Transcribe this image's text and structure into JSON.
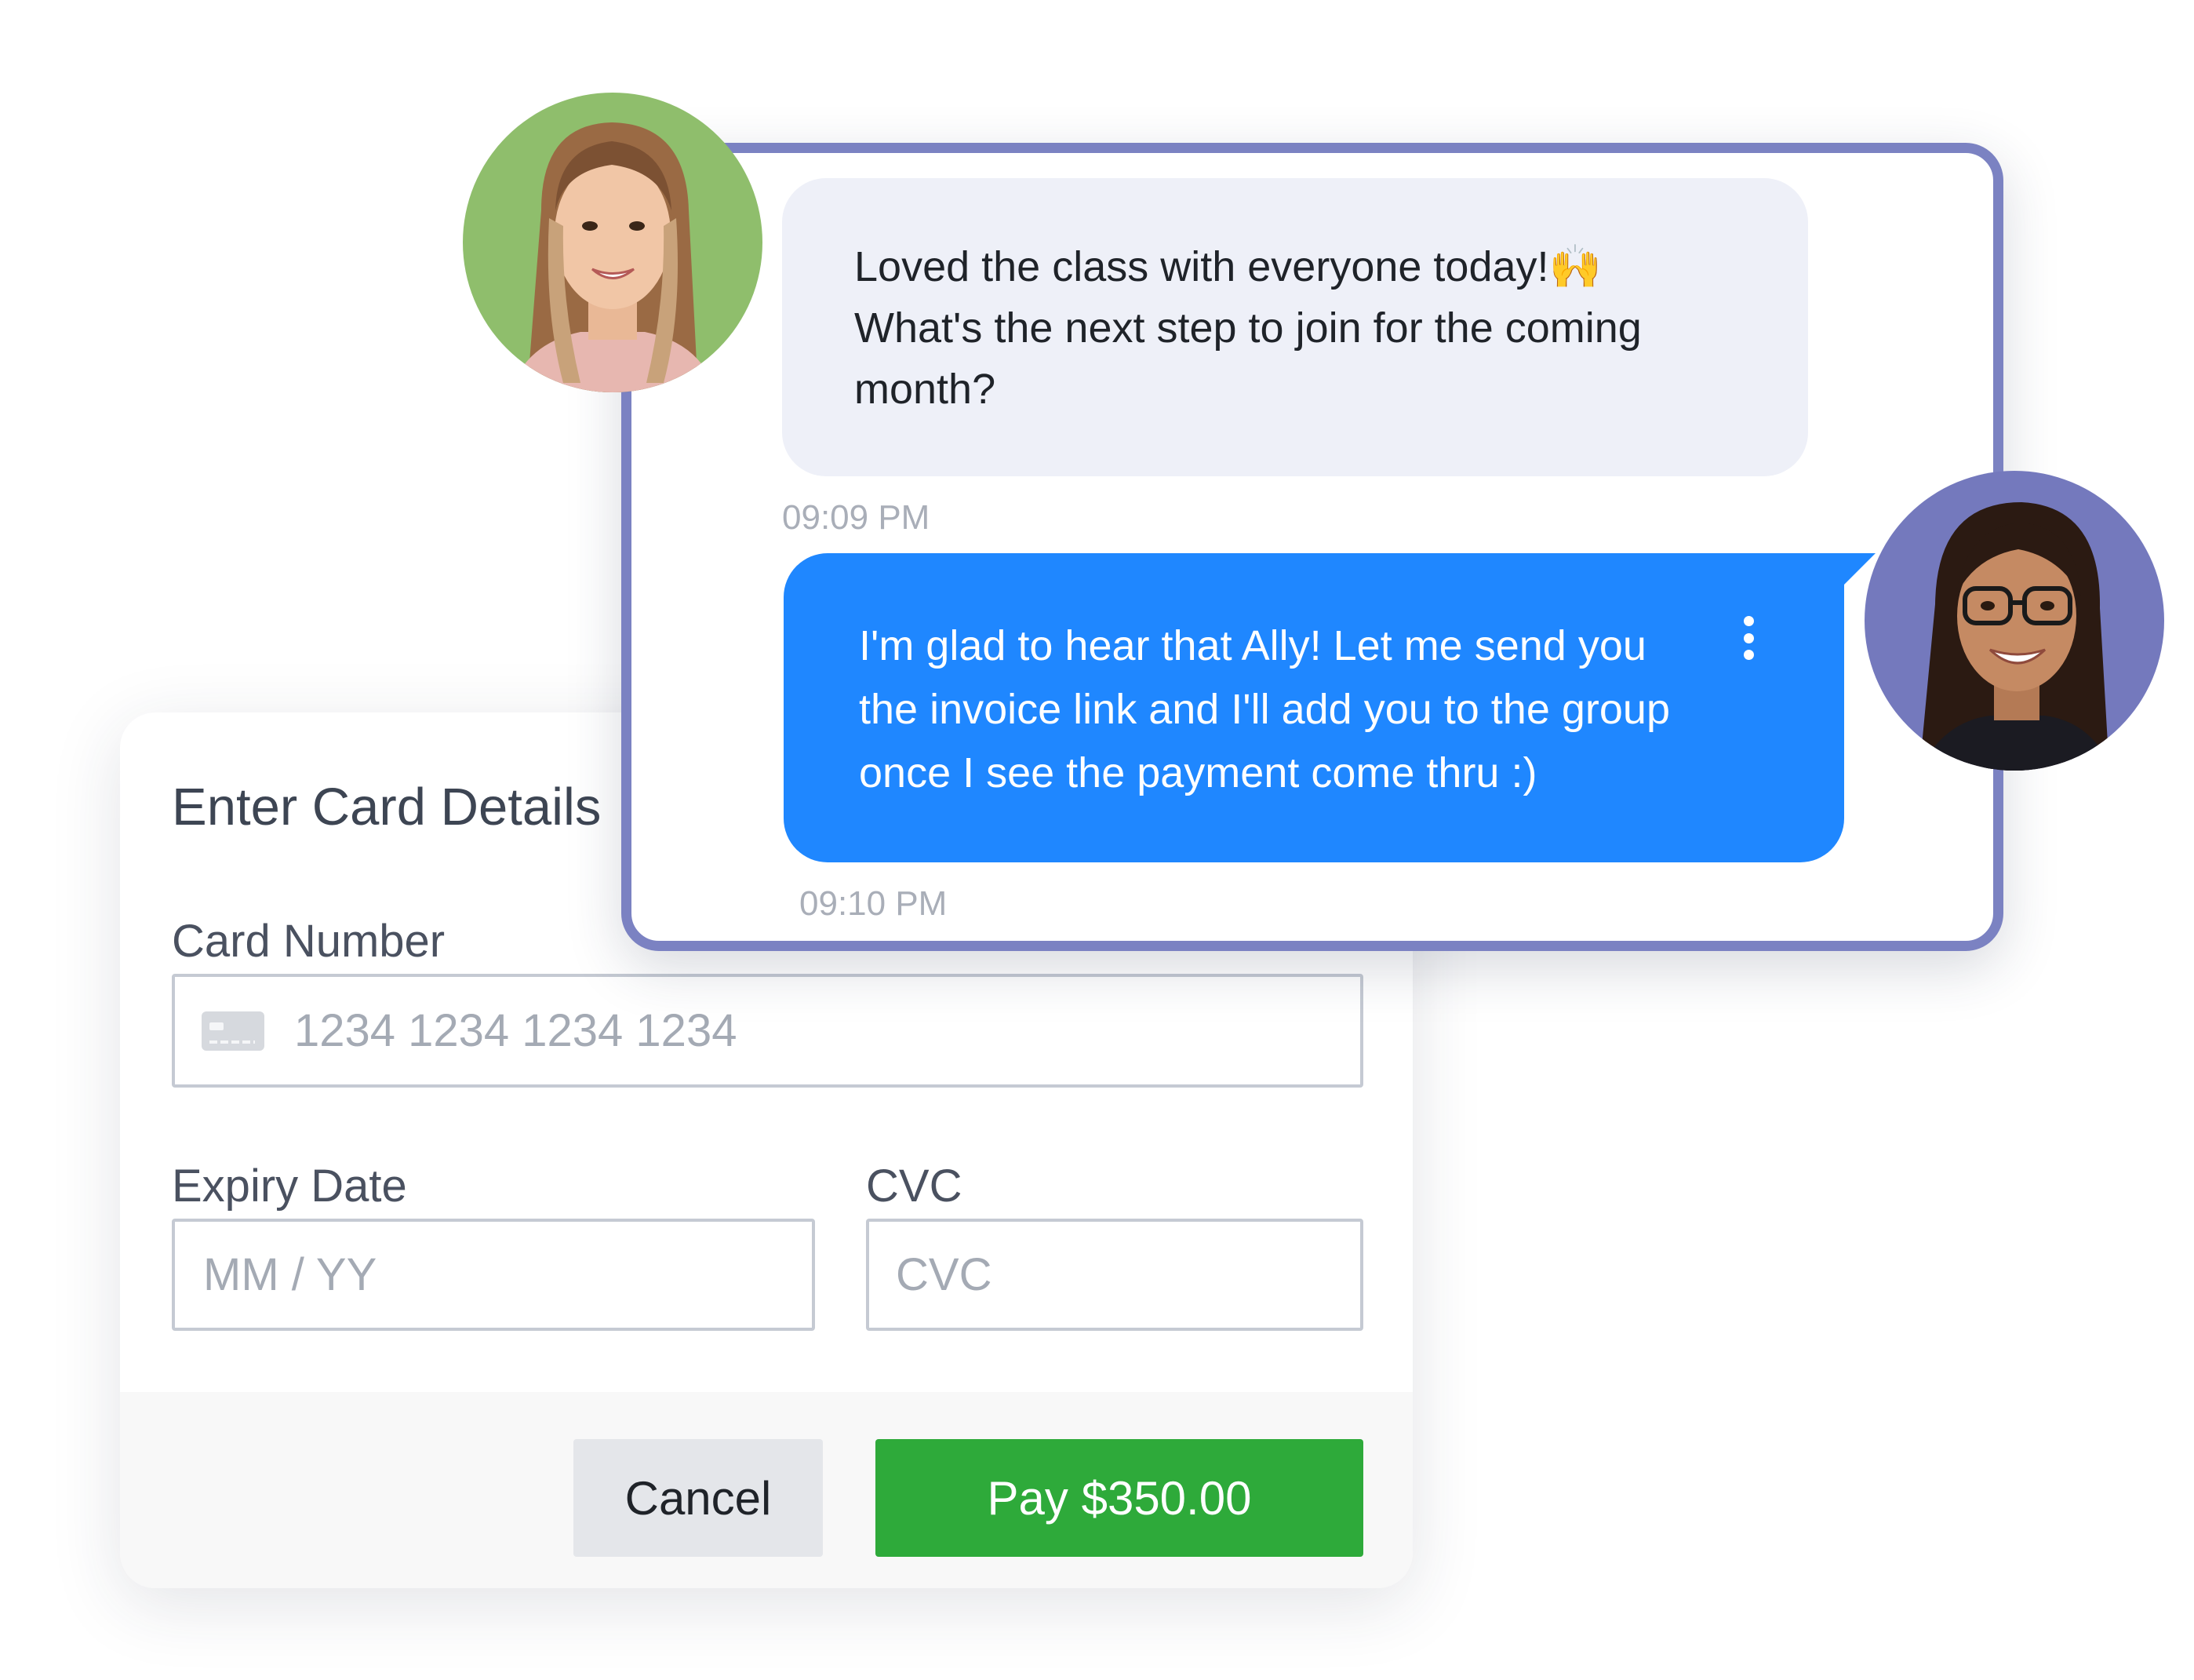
{
  "payment": {
    "title": "Enter Card Details",
    "card_number": {
      "label": "Card Number",
      "placeholder": "1234 1234 1234 1234",
      "icon": "credit-card-icon"
    },
    "expiry": {
      "label": "Expiry Date",
      "placeholder": "MM / YY"
    },
    "cvc": {
      "label": "CVC",
      "placeholder": "CVC"
    },
    "cancel_label": "Cancel",
    "pay_label": "Pay $350.00",
    "pay_color": "#2eaa3a"
  },
  "chat": {
    "border_color": "#7b82c2",
    "messages": [
      {
        "direction": "incoming",
        "text": "Loved the class with everyone today!🙌\nWhat's the next step to join for the coming\nmonth?",
        "time": "09:09 PM"
      },
      {
        "direction": "outgoing",
        "text": "I'm glad to hear that Ally! Let me send you\nthe invoice link and I'll add you to the group\nonce I see the payment come thru :)",
        "time": "09:10 PM",
        "bubble_color": "#1f87ff"
      }
    ]
  }
}
